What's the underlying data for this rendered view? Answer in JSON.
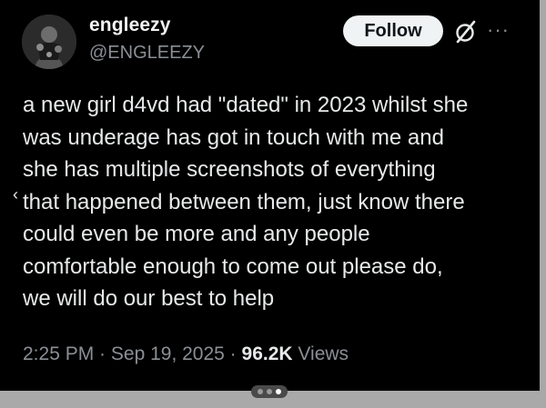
{
  "author": {
    "display_name": "engleezy",
    "handle": "@ENGLEEZY"
  },
  "actions": {
    "follow_label": "Follow",
    "grok_icon": "grok-icon",
    "more_icon": "more-horizontal-icon",
    "more_glyph": "···"
  },
  "tweet": {
    "text": "a new girl d4vd had \"dated\" in 2023 whilst she\nwas underage has got in touch with me and\nshe has multiple screenshots of everything\nthat happened between them, just know there\ncould even be more and any people\ncomfortable enough to come out please do,\nwe will do our best to help"
  },
  "meta": {
    "time": "2:25 PM",
    "separator": " · ",
    "date": "Sep 19, 2025",
    "views_count": "96.2K",
    "views_label": "Views"
  },
  "overlay": {
    "back_glyph": "‹",
    "pager": {
      "total": 3,
      "active_index": 2
    }
  },
  "colors": {
    "background": "#000000",
    "text_primary": "#e7e9ea",
    "text_secondary": "#8b8f94",
    "follow_button_bg": "#eff3f4",
    "follow_button_text": "#0f1419"
  }
}
